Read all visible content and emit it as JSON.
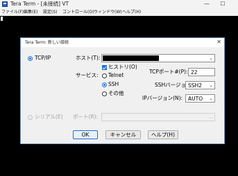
{
  "window": {
    "title": "Tera Term - [未接続] VT",
    "minimize_glyph": "—",
    "maximize_glyph": "☐"
  },
  "menu": [
    {
      "label": "ファイル(F)"
    },
    {
      "label": "編集(E)"
    },
    {
      "label": "設定(S)"
    },
    {
      "label": "コントロール(O)"
    },
    {
      "label": "ウィンドウ(W)"
    },
    {
      "label": "ヘルプ(H)"
    }
  ],
  "dialog": {
    "title": "Tera Term: 新しい接続",
    "close_glyph": "✕",
    "tcpip_label": "TCP/IP",
    "host_label": "ホスト(T):",
    "host_value": "",
    "history_label": "ヒストリ(O)",
    "service_label": "サービス:",
    "services": [
      {
        "label": "Telnet",
        "selected": false
      },
      {
        "label": "SSH",
        "selected": true
      },
      {
        "label": "その他",
        "selected": false
      }
    ],
    "tcp_port_label": "TCPポート#(P):",
    "tcp_port_value": "22",
    "ssh_version_label": "SSHバージョン(V):",
    "ssh_version_value": "SSH2",
    "ip_version_label": "IPバージョン(N):",
    "ip_version_value": "AUTO",
    "serial_label": "シリアル(E)",
    "port_label": "ポート(R):",
    "port_value": "",
    "ok_label": "OK",
    "cancel_label": "キャンセル",
    "help_label": "ヘルプ(H)"
  },
  "icons": {
    "dropdown": "⌄"
  },
  "colors": {
    "accent": "#1f6fd0",
    "terminal_bg": "#000000"
  }
}
